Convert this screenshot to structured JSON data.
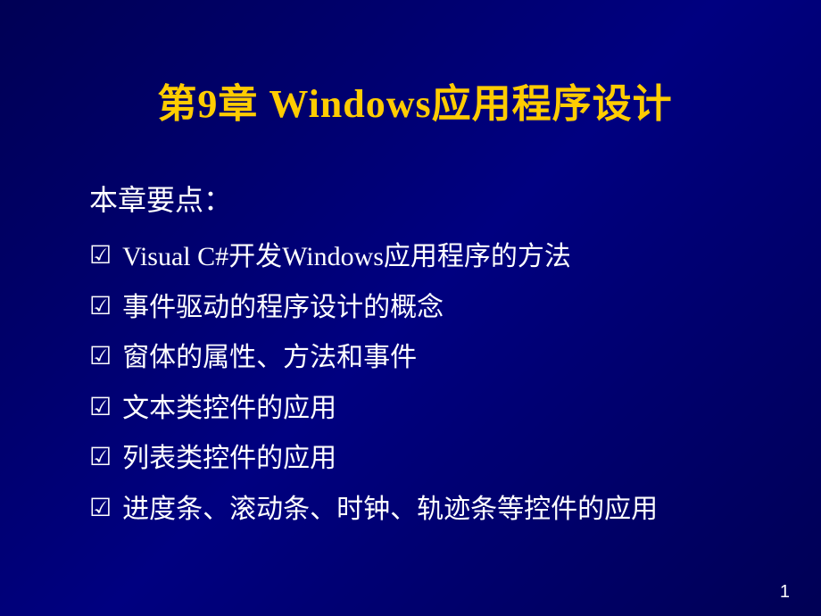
{
  "slide": {
    "title": "第9章  Windows应用程序设计",
    "subtitle": "本章要点：",
    "bullets": [
      {
        "text": "Visual C#开发Windows应用程序的方法"
      },
      {
        "text": "事件驱动的程序设计的概念"
      },
      {
        "text": "窗体的属性、方法和事件"
      },
      {
        "text": "文本类控件的应用"
      },
      {
        "text": "列表类控件的应用"
      },
      {
        "text": "进度条、滚动条、时钟、轨迹条等控件的应用"
      }
    ],
    "page_number": "1"
  }
}
